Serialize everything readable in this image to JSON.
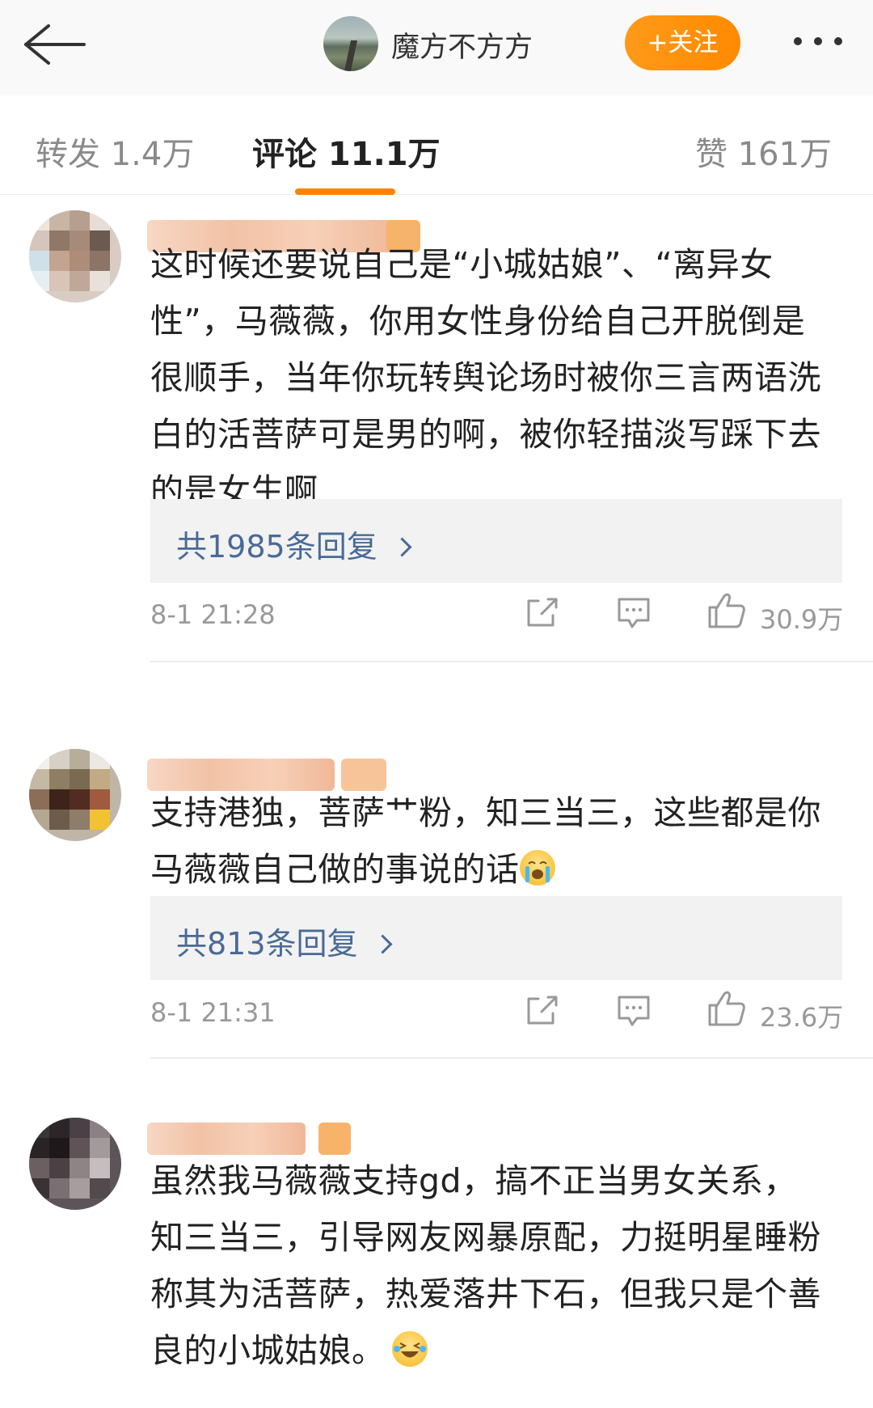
{
  "header": {
    "title": "魔方不方方",
    "follow_label": "+关注",
    "avatar_icon": "landscape-avatar"
  },
  "tabs": {
    "repost": "转发 1.4万",
    "comments": "评论 11.1万",
    "likes": "赞 161万",
    "accent": "#ff8200"
  },
  "comments": [
    {
      "text": "这时候还要说自己是“小城姑娘”、“离异女性”，马薇薇，你用女性身份给自己开脱倒是很顺手，当年你玩转舆论场时被你三言两语洗白的活菩萨可是男的啊，被你轻描淡写踩下去的是女生啊",
      "replies": "共1985条回复",
      "time": "8-1 21:28",
      "likes": "30.9万"
    },
    {
      "text": "支持港独，菩萨艹粉，知三当三，这些都是你马薇薇自己做的事说的话",
      "replies": "共813条回复",
      "time": "8-1 21:31",
      "likes": "23.6万",
      "emoji": "crying-face-emoji"
    },
    {
      "text": "虽然我马薇薇支持gd，搞不正当男女关系，知三当三，引导网友网暴原配，力挺明星睡粉称其为活菩萨，热爱落井下石，但我只是个善良的小城姑娘。",
      "emoji": "laughing-crying-emoji"
    }
  ]
}
